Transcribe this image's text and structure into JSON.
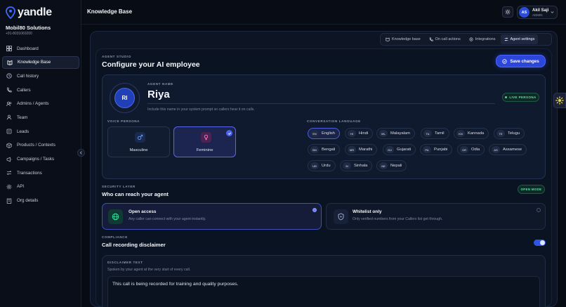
{
  "brand": {
    "name": "yandle",
    "org_name": "Mobil80 Solutions",
    "org_phone": "+91-8031069200"
  },
  "sidebar": {
    "items": [
      {
        "label": "Dashboard",
        "icon": "dashboard-icon"
      },
      {
        "label": "Knowledge Base",
        "icon": "book-icon",
        "active": true
      },
      {
        "label": "Call history",
        "icon": "history-icon"
      },
      {
        "label": "Callers",
        "icon": "phone-icon"
      },
      {
        "label": "Admins / Agents",
        "icon": "users-icon"
      },
      {
        "label": "Team",
        "icon": "team-icon"
      },
      {
        "label": "Leads",
        "icon": "leads-icon"
      },
      {
        "label": "Products / Contexts",
        "icon": "box-icon"
      },
      {
        "label": "Campaigns / Tasks",
        "icon": "campaign-icon"
      },
      {
        "label": "Transactions",
        "icon": "transactions-icon"
      },
      {
        "label": "API",
        "icon": "api-icon"
      },
      {
        "label": "Org details",
        "icon": "org-icon"
      }
    ]
  },
  "header": {
    "title": "Knowledge Base"
  },
  "user": {
    "initials": "AS",
    "name": "Akil Saji",
    "role": "ADMIN"
  },
  "tabs": [
    {
      "label": "Knowledge base",
      "icon": "book-icon"
    },
    {
      "label": "On call actions",
      "icon": "phone-icon"
    },
    {
      "label": "Integrations",
      "icon": "integrations-icon"
    },
    {
      "label": "Agent settings",
      "icon": "sliders-icon",
      "active": true
    }
  ],
  "studio": {
    "eyebrow": "AGENT STUDIO",
    "title": "Configure your AI employee",
    "save_label": "Save changes"
  },
  "agent": {
    "initials": "RI",
    "name_label": "AGENT NAME",
    "name": "Riya",
    "hint": "Include this name in your system prompt so callers hear it on calls.",
    "live_badge": "LIVE PERSONA"
  },
  "voice": {
    "label": "VOICE PERSONA",
    "options": [
      {
        "label": "Masculine",
        "icon": "male-icon"
      },
      {
        "label": "Feminine",
        "icon": "female-icon",
        "selected": true
      }
    ]
  },
  "language": {
    "label": "CONVERSATION LANGUAGE",
    "options": [
      {
        "code": "EN",
        "name": "English",
        "selected": true
      },
      {
        "code": "HI",
        "name": "Hindi"
      },
      {
        "code": "ML",
        "name": "Malayalam"
      },
      {
        "code": "TA",
        "name": "Tamil"
      },
      {
        "code": "KN",
        "name": "Kannada"
      },
      {
        "code": "TE",
        "name": "Telugu"
      },
      {
        "code": "BN",
        "name": "Bengali"
      },
      {
        "code": "MR",
        "name": "Marathi"
      },
      {
        "code": "GU",
        "name": "Gujarati"
      },
      {
        "code": "PA",
        "name": "Punjabi"
      },
      {
        "code": "OR",
        "name": "Odia"
      },
      {
        "code": "AS",
        "name": "Assamese"
      },
      {
        "code": "UR",
        "name": "Urdu"
      },
      {
        "code": "SI",
        "name": "Sinhala"
      },
      {
        "code": "NE",
        "name": "Nepali"
      }
    ]
  },
  "security": {
    "eyebrow": "SECURITY LAYER",
    "title": "Who can reach your agent",
    "mode_badge": "OPEN MODE",
    "options": [
      {
        "title": "Open access",
        "desc": "Any caller can connect with your agent instantly.",
        "icon": "globe-icon",
        "selected": true
      },
      {
        "title": "Whitelist only",
        "desc": "Only verified numbers from your Callers list get through.",
        "icon": "shield-icon"
      }
    ]
  },
  "compliance": {
    "eyebrow": "COMPLIANCE",
    "title": "Call recording disclaimer",
    "enabled": true,
    "disclaimer_label": "DISCLAIMER TEXT",
    "disclaimer_hint": "Spoken by your agent at the very start of every call.",
    "disclaimer_text": "This call is being recorded for training and quality purposes."
  },
  "colors": {
    "accent": "#2b46d9",
    "success": "#3fe0a0",
    "background": "#070b14"
  }
}
